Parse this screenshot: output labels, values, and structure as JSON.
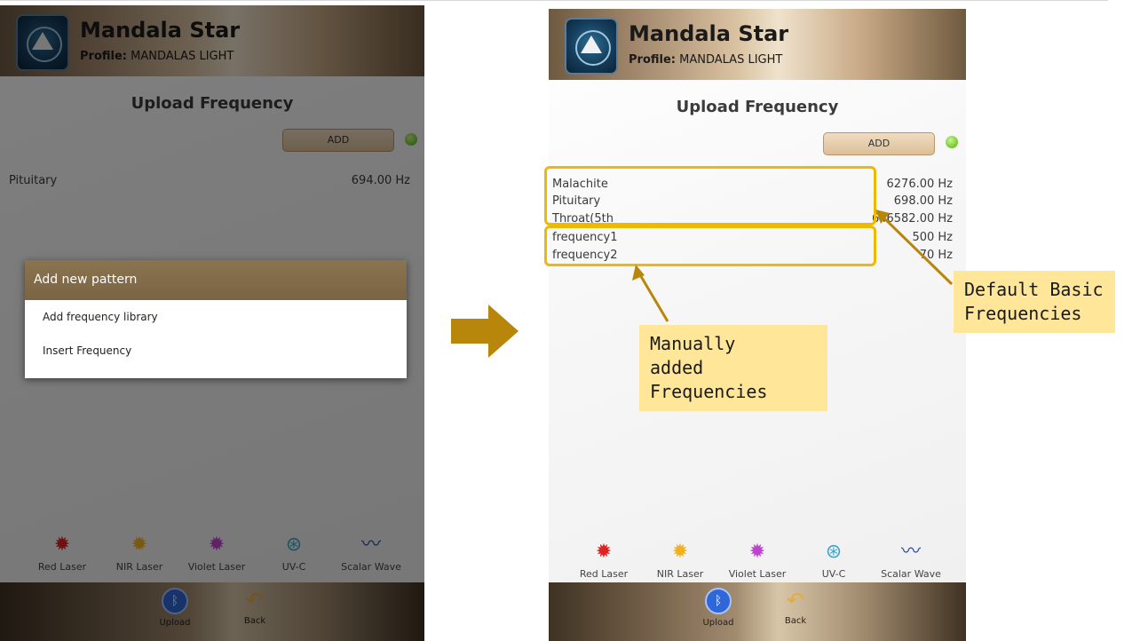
{
  "left": {
    "app_title": "Mandala Star",
    "profile_label": "Profile:",
    "profile_name": "MANDALAS LIGHT",
    "page_title": "Upload Frequency",
    "add_label": "ADD",
    "frequencies": [
      {
        "name": "Pituitary",
        "value": "694.00 Hz"
      }
    ],
    "dialog": {
      "title": "Add new pattern",
      "items": [
        "Add frequency library",
        "Insert Frequency"
      ]
    }
  },
  "right": {
    "app_title": "Mandala Star",
    "profile_label": "Profile:",
    "profile_name": "MANDALAS LIGHT",
    "page_title": "Upload Frequency",
    "add_label": "ADD",
    "frequencies": [
      {
        "name": "Malachite",
        "value": "6276.00 Hz"
      },
      {
        "name": "Pituitary",
        "value": "698.00 Hz"
      },
      {
        "name": "Throat(5th",
        "value": "646582.00 Hz"
      },
      {
        "name": "frequency1",
        "value": "500 Hz"
      },
      {
        "name": "frequency2",
        "value": "70 Hz"
      }
    ]
  },
  "bottom_icons": [
    {
      "label": "Red Laser",
      "icon": "red-laser-icon",
      "color": "#e12222"
    },
    {
      "label": "NIR Laser",
      "icon": "nir-laser-icon",
      "color": "#f2b01e"
    },
    {
      "label": "Violet Laser",
      "icon": "violet-laser-icon",
      "color": "#c043d0"
    },
    {
      "label": "UV-C",
      "icon": "uvc-icon",
      "color": "#3aa5c9"
    },
    {
      "label": "Scalar Wave",
      "icon": "scalar-wave-icon",
      "color": "#2450b8"
    }
  ],
  "footer": {
    "upload_label": "Upload",
    "back_label": "Back"
  },
  "annotations": {
    "default_callout": [
      "Default Basic",
      "Frequencies"
    ],
    "manual_callout": [
      "Manually",
      "added",
      "Frequencies"
    ],
    "highlight_color": "#f0b800",
    "callout_bg": "#ffe699",
    "arrow_color": "#b8860b"
  }
}
